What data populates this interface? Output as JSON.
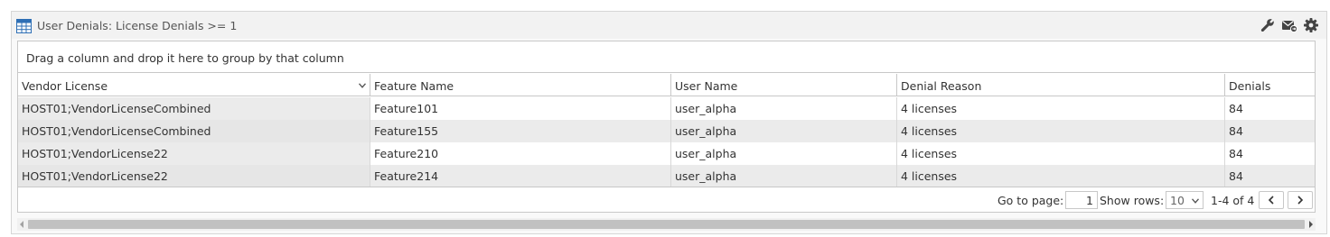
{
  "panel": {
    "title": "User Denials: License Denials >= 1",
    "icons": [
      "table-icon",
      "wrench-icon",
      "email-icon",
      "gear-icon"
    ]
  },
  "grid": {
    "group_hint": "Drag a column and drop it here to group by that column",
    "columns": [
      "Vendor License",
      "Feature Name",
      "User Name",
      "Denial Reason",
      "Denials"
    ],
    "rows": [
      [
        "HOST01;VendorLicenseCombined",
        "Feature101",
        "user_alpha",
        "4 licenses",
        "84"
      ],
      [
        "HOST01;VendorLicenseCombined",
        "Feature155",
        "user_alpha",
        "4 licenses",
        "84"
      ],
      [
        "HOST01;VendorLicense22",
        "Feature210",
        "user_alpha",
        "4 licenses",
        "84"
      ],
      [
        "HOST01;VendorLicense22",
        "Feature214",
        "user_alpha",
        "4 licenses",
        "84"
      ]
    ]
  },
  "pager": {
    "go_to_page_label": "Go to page:",
    "page_value": "1",
    "show_rows_label": "Show rows:",
    "rows_value": "10",
    "range_text": "1-4 of 4"
  },
  "colors": {
    "header_bg": "#f2f2f2",
    "alt_row_bg": "#ebebeb",
    "border": "#c8c8c8",
    "icon_blue": "#2e6fb5"
  }
}
